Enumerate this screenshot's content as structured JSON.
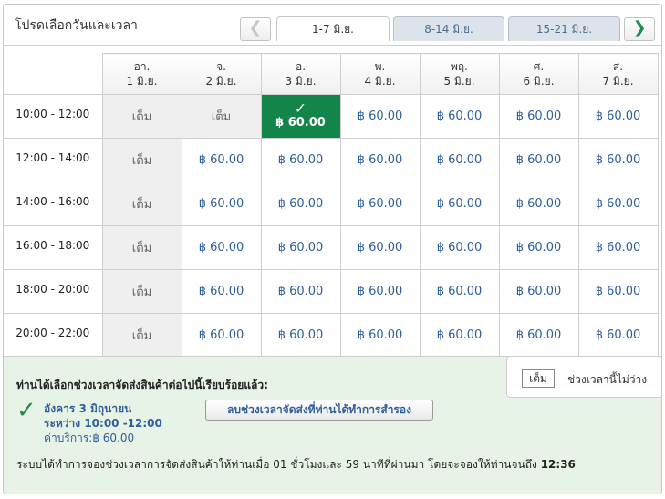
{
  "header": {
    "title": "โปรดเลือกวันและเวลา",
    "prev_symbol": "❮",
    "next_symbol": "❯",
    "weeks": [
      {
        "label": "1-7 มิ.ย.",
        "active": true
      },
      {
        "label": "8-14 มิ.ย.",
        "active": false
      },
      {
        "label": "15-21 มิ.ย.",
        "active": false
      }
    ]
  },
  "days": [
    {
      "weekday": "อา.",
      "date": "1 มิ.ย."
    },
    {
      "weekday": "จ.",
      "date": "2 มิ.ย."
    },
    {
      "weekday": "อ.",
      "date": "3 มิ.ย."
    },
    {
      "weekday": "พ.",
      "date": "4 มิ.ย."
    },
    {
      "weekday": "พฤ.",
      "date": "5 มิ.ย."
    },
    {
      "weekday": "ศ.",
      "date": "6 มิ.ย."
    },
    {
      "weekday": "ส.",
      "date": "7 มิ.ย."
    }
  ],
  "labels": {
    "full": "เต็ม",
    "price": "฿ 60.00",
    "check": "✓"
  },
  "rows": [
    {
      "time": "10:00 - 12:00",
      "slots": [
        "full",
        "full",
        "selected",
        "open",
        "open",
        "open",
        "open"
      ]
    },
    {
      "time": "12:00 - 14:00",
      "slots": [
        "full",
        "open",
        "open",
        "open",
        "open",
        "open",
        "open"
      ]
    },
    {
      "time": "14:00 - 16:00",
      "slots": [
        "full",
        "open",
        "open",
        "open",
        "open",
        "open",
        "open"
      ]
    },
    {
      "time": "16:00 - 18:00",
      "slots": [
        "full",
        "open",
        "open",
        "open",
        "open",
        "open",
        "open"
      ]
    },
    {
      "time": "18:00 - 20:00",
      "slots": [
        "full",
        "open",
        "open",
        "open",
        "open",
        "open",
        "open"
      ]
    },
    {
      "time": "20:00 - 22:00",
      "slots": [
        "full",
        "open",
        "open",
        "open",
        "open",
        "open",
        "open"
      ]
    }
  ],
  "legend": {
    "chip": "เต็ม",
    "text": "ช่วงเวลานี้ไม่ว่าง"
  },
  "confirmation": {
    "heading": "ท่านได้เลือกช่วงเวลาจัดส่งสินค้าต่อไปนี้เรียบร้อยแล้ว:",
    "check": "✓",
    "date": "อังคาร 3 มิถุนายน",
    "time": "ระหว่าง 10:00 -12:00",
    "fee": "ค่าบริการ:฿ 60.00",
    "remove_button": "ลบช่วงเวลาจัดส่งที่ท่านได้ทำการสำรอง",
    "note_prefix": "ระบบได้ทำการจองช่วงเวลาการจัดส่งสินค้าให้ท่านเมื่อ 01 ชั่วโมงและ 59 นาทีที่ผ่านมา โดยจะจองให้ท่านจนถึง",
    "note_time": "12:36"
  },
  "colors": {
    "selected": "#13854a",
    "full": "#efefef",
    "link": "#2f5f9a",
    "confirm_bg": "#e8f3e7"
  }
}
